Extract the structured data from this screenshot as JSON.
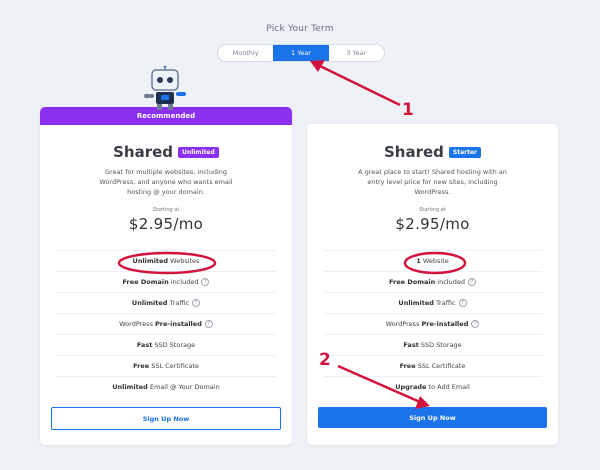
{
  "term": {
    "title": "Pick Your Term",
    "options": [
      "Monthly",
      "1 Year",
      "3 Year"
    ],
    "selected": "1 Year"
  },
  "left_plan": {
    "ribbon": "Recommended",
    "name": "Shared",
    "badge": "Unlimited",
    "description": "Great for multiple websites, including WordPress, and anyone who wants email hosting @ your domain.",
    "starting_label": "Starting at",
    "price": "$2.95/mo",
    "features": [
      {
        "bold": "Unlimited",
        "text": " Websites",
        "info": false
      },
      {
        "bold": "Free Domain",
        "text": " included",
        "info": true
      },
      {
        "bold": "Unlimited",
        "text": " Traffic",
        "info": true
      },
      {
        "pre": "WordPress ",
        "bold": "Pre-installed",
        "info": true
      },
      {
        "bold": "Fast",
        "text": " SSD Storage",
        "info": false
      },
      {
        "bold": "Free",
        "text": " SSL Certificate",
        "info": false
      },
      {
        "bold": "Unlimited",
        "text": " Email @ Your Domain",
        "info": false
      }
    ],
    "button": "Sign Up Now"
  },
  "right_plan": {
    "name": "Shared",
    "badge": "Starter",
    "description": "A great place to start! Shared hosting with an entry level price for new sites, including WordPress.",
    "starting_label": "Starting at",
    "price": "$2.95/mo",
    "features": [
      {
        "bold": "1",
        "text": " Website",
        "info": false
      },
      {
        "bold": "Free Domain",
        "text": " included",
        "info": true
      },
      {
        "bold": "Unlimited",
        "text": " Traffic",
        "info": true
      },
      {
        "pre": "WordPress ",
        "bold": "Pre-installed",
        "info": true
      },
      {
        "bold": "Fast",
        "text": " SSD Storage",
        "info": false
      },
      {
        "bold": "Free",
        "text": " SSL Certificate",
        "info": false
      },
      {
        "bold": "Upgrade",
        "text": " to Add Email",
        "info": false
      }
    ],
    "button": "Sign Up Now"
  },
  "annotations": {
    "label_1": "1",
    "label_2": "2",
    "color": "#d2143d"
  },
  "colors": {
    "accent_blue": "#1a73e8",
    "accent_purple": "#8b2ff0",
    "background": "#eef1f6"
  }
}
